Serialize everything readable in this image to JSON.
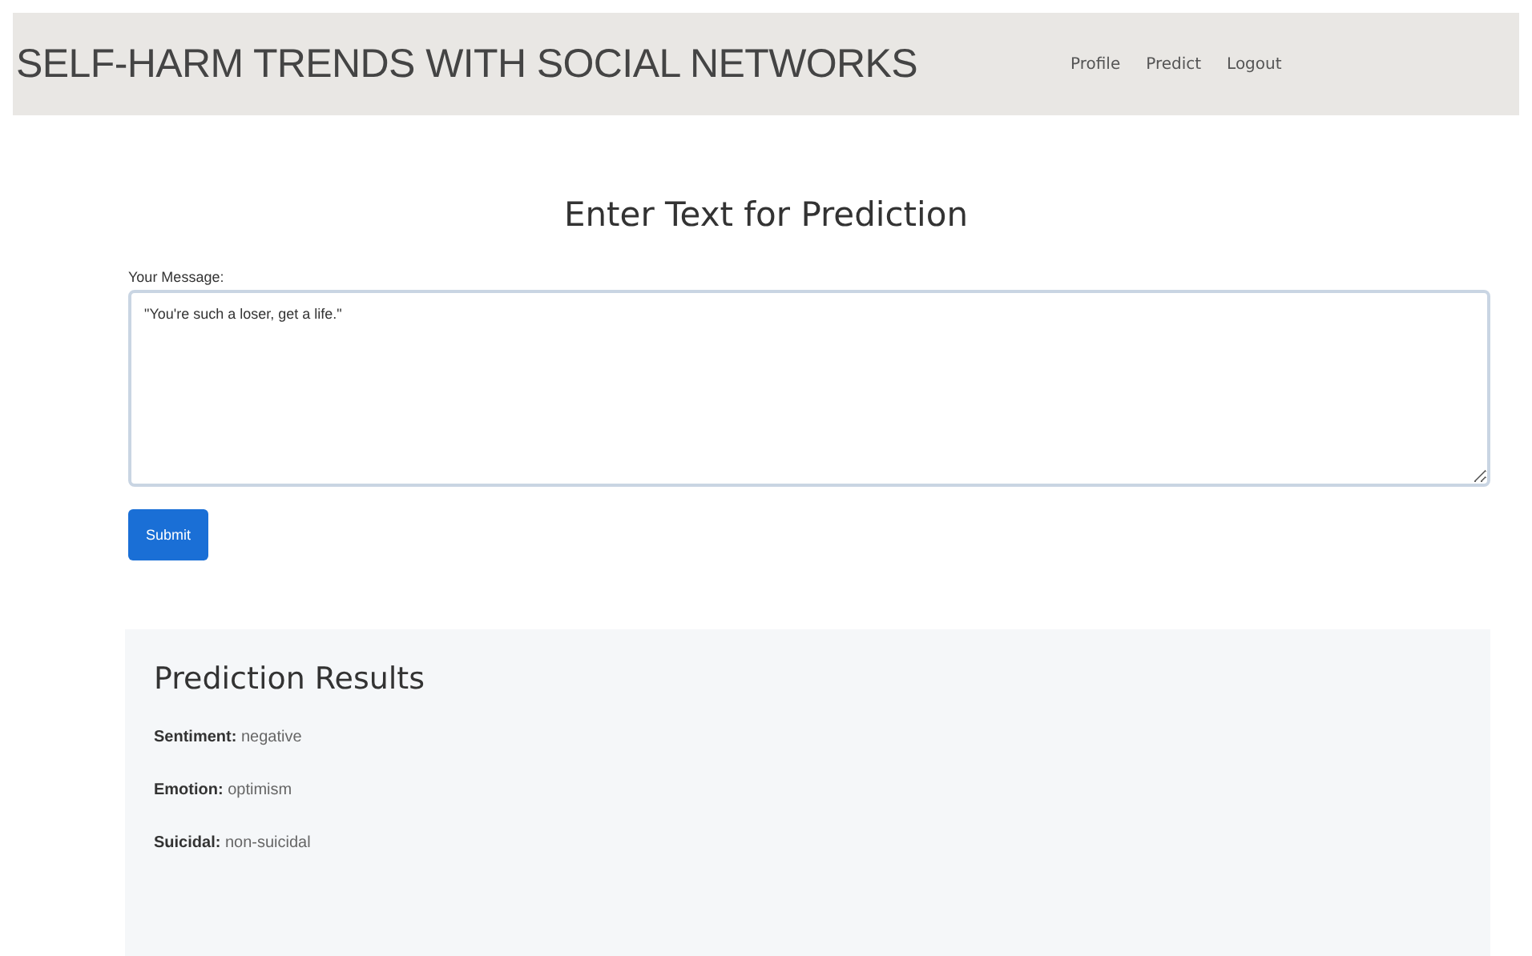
{
  "navbar": {
    "title": "SELF-HARM TRENDS WITH SOCIAL NETWORKS",
    "links": [
      "Profile",
      "Predict",
      "Logout"
    ]
  },
  "form": {
    "heading": "Enter Text for Prediction",
    "label": "Your Message:",
    "value": "\"You're such a loser, get a life.\"",
    "button": "Submit"
  },
  "results": {
    "heading": "Prediction Results",
    "lines": [
      "**Sentiment:** negative",
      "**Emotion:** optimism",
      "**Suicidal:** non-suicidal"
    ]
  }
}
